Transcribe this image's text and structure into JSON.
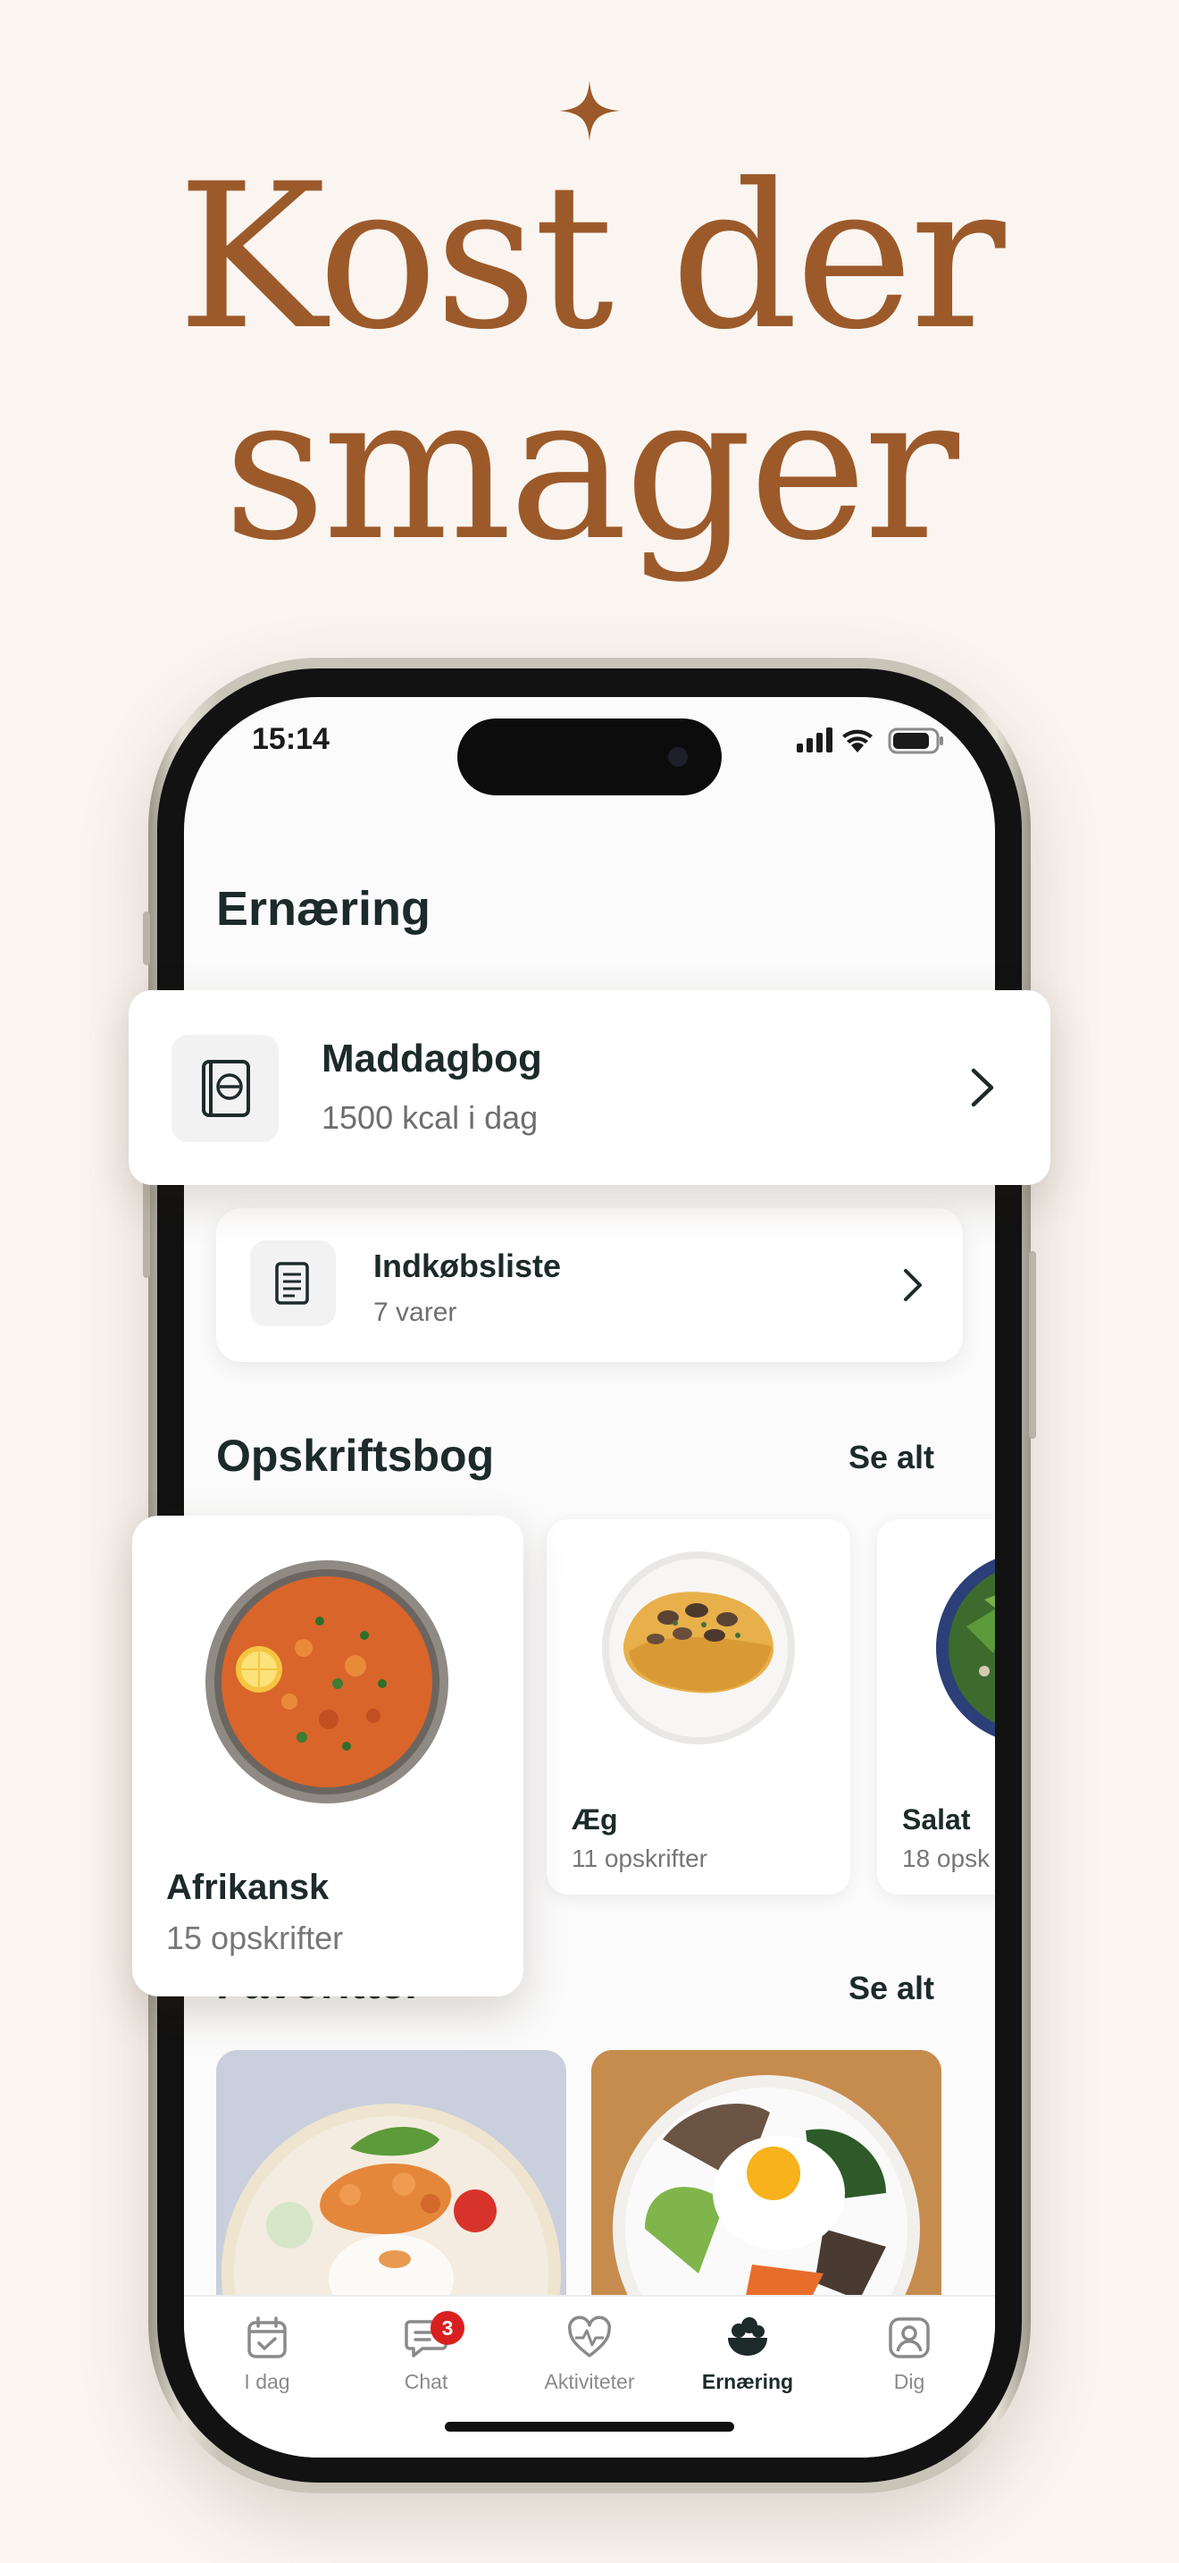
{
  "headline": {
    "line1": "Kost der",
    "line2": "smager"
  },
  "colors": {
    "accent": "#9c5a2b",
    "background": "#faf5f0",
    "badge": "#d92020",
    "text": "#1d2a2a"
  },
  "status_bar": {
    "time": "15:14"
  },
  "screen": {
    "title": "Ernæring"
  },
  "food_diary": {
    "title": "Maddagbog",
    "subtitle": "1500 kcal i dag",
    "icon": "book-icon"
  },
  "shopping_list": {
    "title": "Indkøbsliste",
    "subtitle": "7 varer",
    "icon": "receipt-icon"
  },
  "cookbook": {
    "title": "Opskriftsbog",
    "see_all": "Se alt",
    "items": [
      {
        "name": "Afrikansk",
        "count": "15 opskrifter"
      },
      {
        "name": "Æg",
        "count": "11 opskrifter"
      },
      {
        "name": "Salat",
        "count": "18 opsk"
      }
    ]
  },
  "favorites": {
    "title": "Favoritter",
    "see_all": "Se alt"
  },
  "tabbar": {
    "tabs": [
      {
        "label": "I dag",
        "icon": "calendar-icon"
      },
      {
        "label": "Chat",
        "icon": "chat-icon",
        "badge": "3"
      },
      {
        "label": "Aktiviteter",
        "icon": "heart-pulse-icon"
      },
      {
        "label": "Ernæring",
        "icon": "food-bowl-icon",
        "active": true
      },
      {
        "label": "Dig",
        "icon": "profile-icon"
      }
    ]
  }
}
